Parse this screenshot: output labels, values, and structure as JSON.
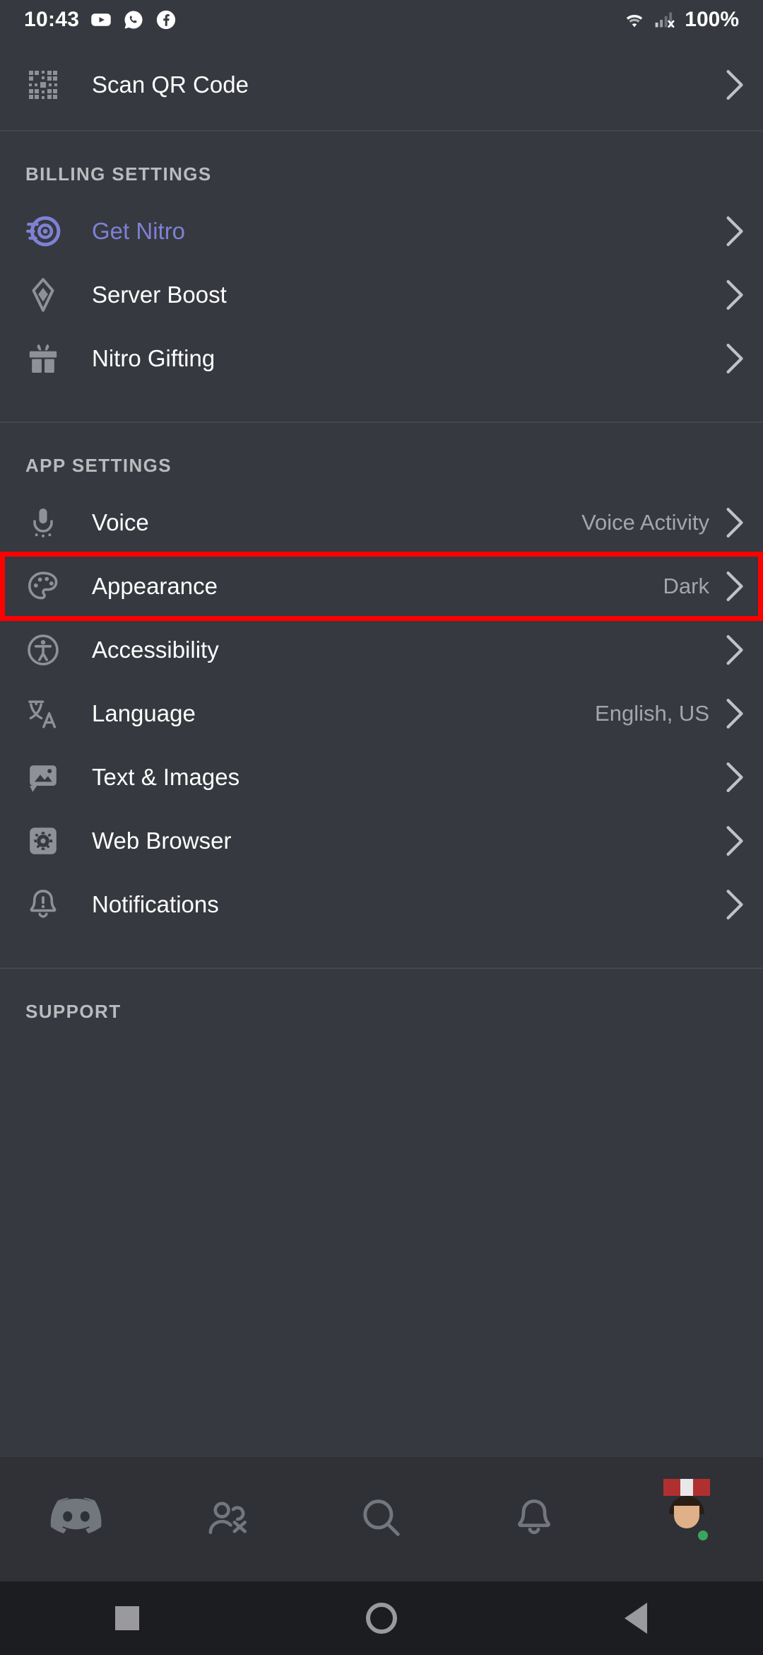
{
  "status_bar": {
    "time": "10:43",
    "battery": "100%",
    "app_icons": [
      "youtube-icon",
      "whatsapp-icon",
      "facebook-icon"
    ],
    "system_icons": [
      "wifi-icon",
      "cellular-no-signal-icon"
    ]
  },
  "colors": {
    "background": "#36393f",
    "nav_background": "#2f3136",
    "accent_nitro": "#7e81d4",
    "highlight_outline": "#ff0000",
    "text_primary": "#ffffff",
    "text_secondary": "#a3a6aa",
    "header_text": "#b9bbbe",
    "online_status": "#3ba55c"
  },
  "top_section": {
    "rows": [
      {
        "label": "Scan QR Code",
        "icon": "qr-code-icon",
        "value": "",
        "chevron": "chevron-right-icon"
      }
    ]
  },
  "billing_section": {
    "header": "BILLING SETTINGS",
    "rows": [
      {
        "label": "Get Nitro",
        "icon": "nitro-wheel-icon",
        "value": "",
        "chevron": "chevron-right-icon",
        "accent": true
      },
      {
        "label": "Server Boost",
        "icon": "server-boost-icon",
        "value": "",
        "chevron": "chevron-right-icon",
        "accent": false
      },
      {
        "label": "Nitro Gifting",
        "icon": "gift-icon",
        "value": "",
        "chevron": "chevron-right-icon",
        "accent": false
      }
    ]
  },
  "app_section": {
    "header": "APP SETTINGS",
    "rows": [
      {
        "label": "Voice",
        "icon": "microphone-icon",
        "value": "Voice Activity",
        "chevron": "chevron-right-icon",
        "highlighted": false
      },
      {
        "label": "Appearance",
        "icon": "palette-icon",
        "value": "Dark",
        "chevron": "chevron-right-icon",
        "highlighted": true
      },
      {
        "label": "Accessibility",
        "icon": "accessibility-icon",
        "value": "",
        "chevron": "chevron-right-icon",
        "highlighted": false
      },
      {
        "label": "Language",
        "icon": "translate-icon",
        "value": "English, US",
        "chevron": "chevron-right-icon",
        "highlighted": false
      },
      {
        "label": "Text & Images",
        "icon": "image-icon",
        "value": "",
        "chevron": "chevron-right-icon",
        "highlighted": false
      },
      {
        "label": "Web Browser",
        "icon": "browser-gear-icon",
        "value": "",
        "chevron": "chevron-right-icon",
        "highlighted": false
      },
      {
        "label": "Notifications",
        "icon": "bell-icon",
        "value": "",
        "chevron": "chevron-right-icon",
        "highlighted": false
      }
    ]
  },
  "support_section": {
    "header": "SUPPORT"
  },
  "bottom_nav": {
    "items": [
      {
        "name": "servers-tab",
        "icon": "discord-logo-icon"
      },
      {
        "name": "friends-tab",
        "icon": "people-icon"
      },
      {
        "name": "search-tab",
        "icon": "search-icon"
      },
      {
        "name": "notifications-tab",
        "icon": "bell-icon"
      },
      {
        "name": "profile-tab",
        "icon": "avatar-icon"
      }
    ]
  },
  "android_nav": {
    "items": [
      {
        "name": "recent-apps-button",
        "icon": "square-icon"
      },
      {
        "name": "home-button",
        "icon": "circle-icon"
      },
      {
        "name": "back-button",
        "icon": "triangle-back-icon"
      }
    ]
  }
}
